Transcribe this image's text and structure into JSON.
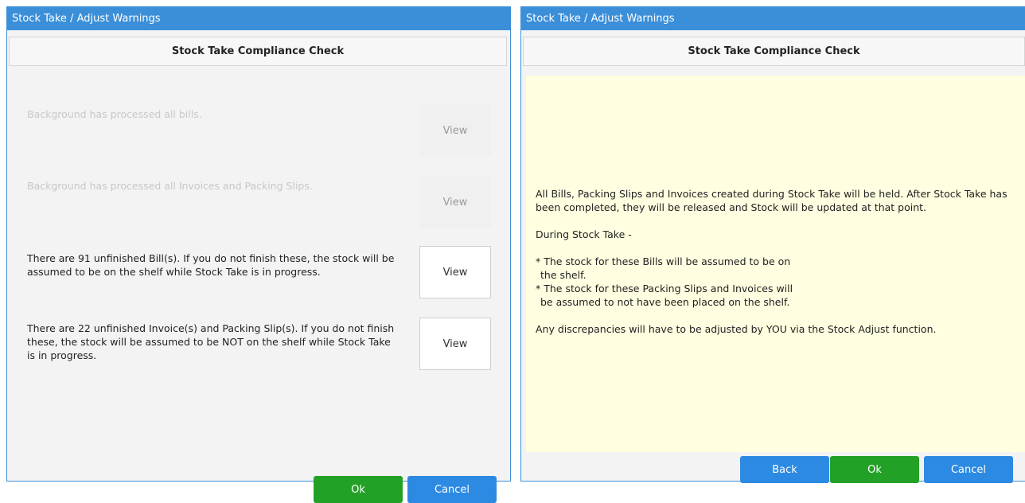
{
  "left_dialog": {
    "title": "Stock Take / Adjust Warnings",
    "header": "Stock Take Compliance Check",
    "checks": [
      {
        "text": "Background has processed all bills.",
        "view_label": "View",
        "enabled": false
      },
      {
        "text": "Background has processed all Invoices and Packing Slips.",
        "view_label": "View",
        "enabled": false
      },
      {
        "text": "There are 91 unfinished Bill(s).  If you do not finish these, the stock will be assumed to be on the shelf while Stock Take is in progress.",
        "view_label": "View",
        "enabled": true
      },
      {
        "text": "There are 22 unfinished Invoice(s) and Packing Slip(s).  If you do not finish these, the stock will be assumed to be NOT on the shelf while Stock Take is in progress.",
        "view_label": "View",
        "enabled": true
      }
    ],
    "buttons": {
      "ok": "Ok",
      "cancel": "Cancel"
    }
  },
  "right_dialog": {
    "title": "Stock Take / Adjust Warnings",
    "header": "Stock Take Compliance Check",
    "notice": {
      "paragraph1": "All Bills, Packing Slips and Invoices created during Stock Take will be held.  After Stock Take has been completed, they will be released and Stock will be updated at that point.",
      "paragraph2": "During Stock Take -",
      "bullet1_line1": "* The stock for these Bills will be assumed to be on",
      "bullet1_line2": "  the shelf.",
      "bullet2_line1": "* The stock for these Packing Slips and Invoices will",
      "bullet2_line2": "  be assumed to not have been placed on the shelf.",
      "paragraph3": "Any discrepancies will have to be adjusted by YOU via the Stock Adjust function."
    },
    "buttons": {
      "back": "Back",
      "ok": "Ok",
      "cancel": "Cancel"
    }
  },
  "colors": {
    "titlebar": "#3b8fd9",
    "ok_button": "#23a127",
    "blue_button": "#2d8ae2",
    "notice_background": "#fffee0"
  }
}
